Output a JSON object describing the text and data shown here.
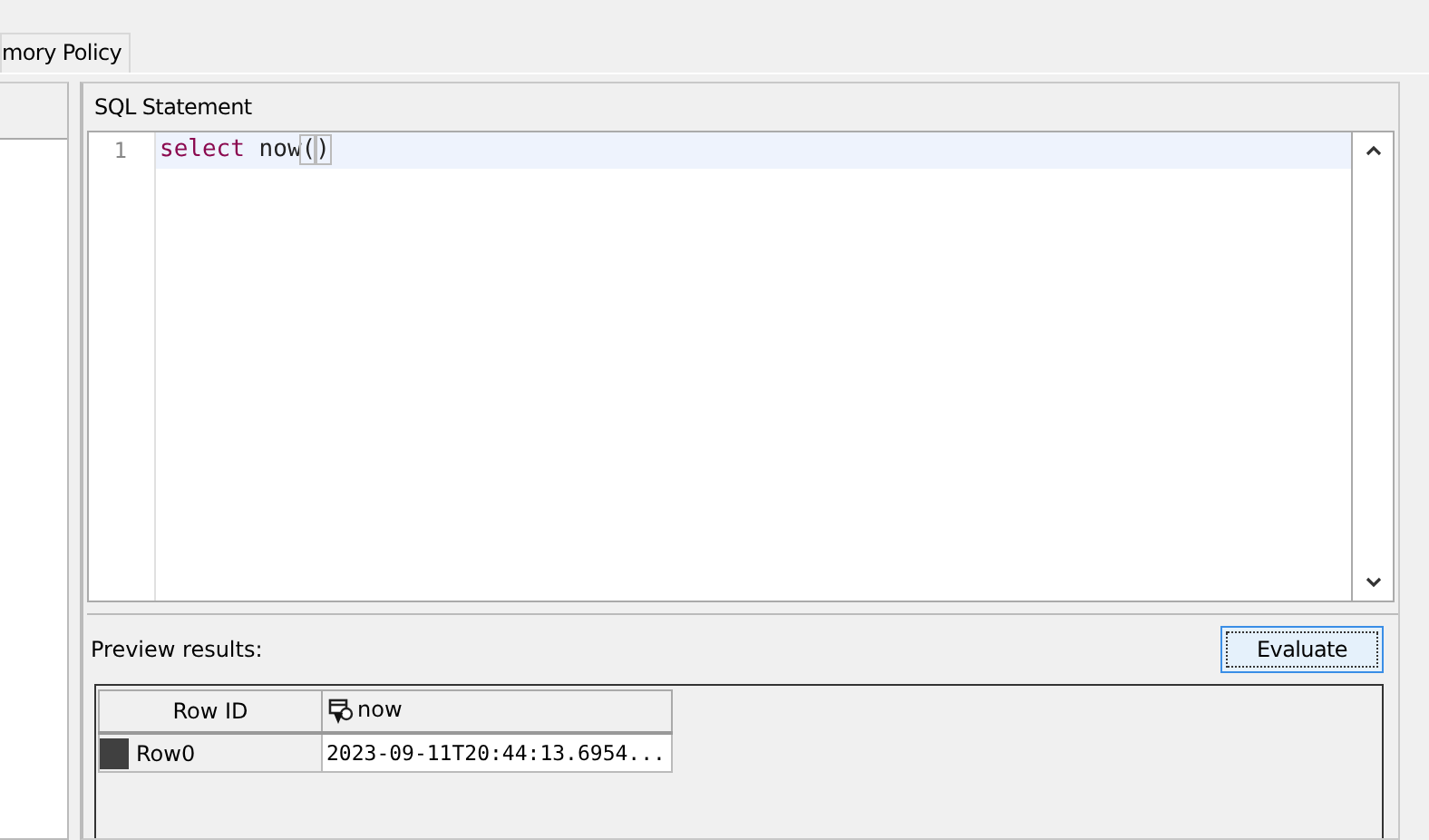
{
  "tabs": [
    {
      "label": "mory Policy"
    }
  ],
  "sql_panel": {
    "title": "SQL Statement",
    "lines": [
      {
        "number": "1",
        "current": true,
        "tokens": [
          {
            "text": "select",
            "kind": "keyword"
          },
          {
            "text": " now",
            "kind": "plain"
          },
          {
            "text": "(",
            "kind": "bracket"
          },
          {
            "text": ")",
            "kind": "bracket"
          }
        ]
      }
    ]
  },
  "preview": {
    "label": "Preview results:",
    "button": "Evaluate",
    "table": {
      "columns": [
        {
          "label": "Row ID",
          "kind": "id"
        },
        {
          "label": "now",
          "kind": "value"
        }
      ],
      "rows": [
        [
          "Row0",
          "2023-09-11T20:44:13.6954..."
        ]
      ]
    }
  }
}
